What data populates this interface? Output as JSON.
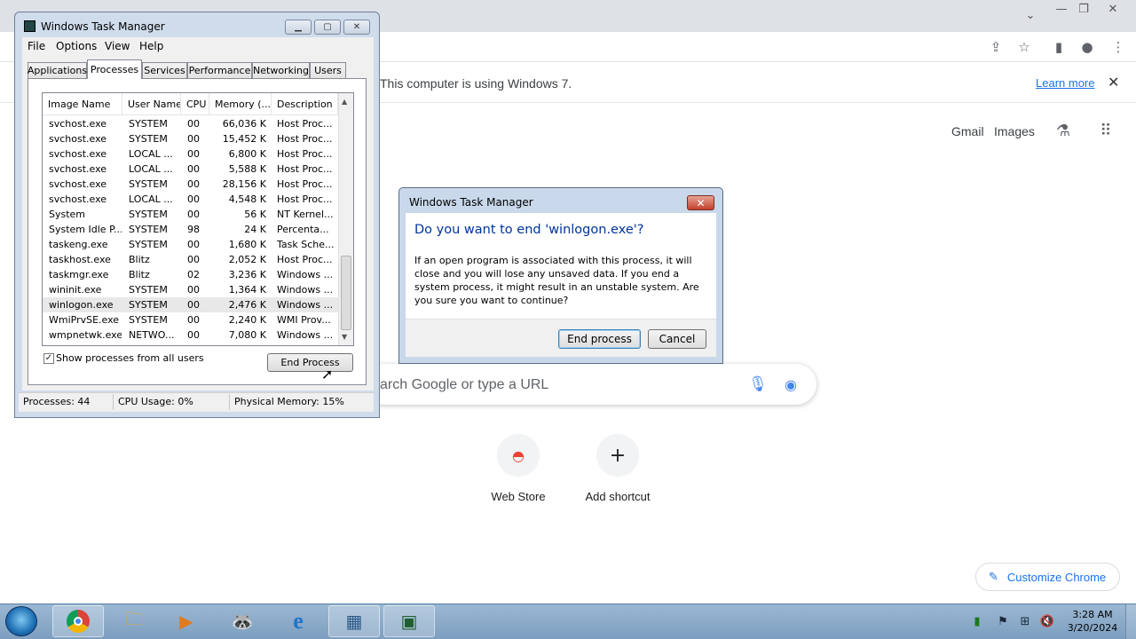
{
  "browser": {
    "infobar": {
      "message": "This computer is using Windows 7.",
      "link": "Learn more"
    },
    "top_links": [
      "Gmail",
      "Images"
    ],
    "search_placeholder": "arch Google or type a URL",
    "shortcuts": [
      {
        "label": "Web Store"
      },
      {
        "label": "Add shortcut"
      }
    ],
    "customize_label": "Customize Chrome",
    "colors": {
      "link": "#1a73e8",
      "tabbar": "#dee1e6"
    }
  },
  "task_manager": {
    "title": "Windows Task Manager",
    "menu": [
      "File",
      "Options",
      "View",
      "Help"
    ],
    "tabs": [
      "Applications",
      "Processes",
      "Services",
      "Performance",
      "Networking",
      "Users"
    ],
    "active_tab": "Processes",
    "columns": [
      "Image Name",
      "User Name",
      "CPU",
      "Memory (...",
      "Description"
    ],
    "rows": [
      [
        "svchost.exe",
        "SYSTEM",
        "00",
        "66,036 K",
        "Host Proc..."
      ],
      [
        "svchost.exe",
        "SYSTEM",
        "00",
        "15,452 K",
        "Host Proc..."
      ],
      [
        "svchost.exe",
        "LOCAL ...",
        "00",
        "6,800 K",
        "Host Proc..."
      ],
      [
        "svchost.exe",
        "LOCAL ...",
        "00",
        "5,588 K",
        "Host Proc..."
      ],
      [
        "svchost.exe",
        "SYSTEM",
        "00",
        "28,156 K",
        "Host Proc..."
      ],
      [
        "svchost.exe",
        "LOCAL ...",
        "00",
        "4,548 K",
        "Host Proc..."
      ],
      [
        "System",
        "SYSTEM",
        "00",
        "56 K",
        "NT Kernel..."
      ],
      [
        "System Idle P...",
        "SYSTEM",
        "98",
        "24 K",
        "Percenta..."
      ],
      [
        "taskeng.exe",
        "SYSTEM",
        "00",
        "1,680 K",
        "Task Sche..."
      ],
      [
        "taskhost.exe",
        "Blitz",
        "00",
        "2,052 K",
        "Host Proc..."
      ],
      [
        "taskmgr.exe",
        "Blitz",
        "02",
        "3,236 K",
        "Windows ..."
      ],
      [
        "wininit.exe",
        "SYSTEM",
        "00",
        "1,364 K",
        "Windows ..."
      ],
      [
        "winlogon.exe",
        "SYSTEM",
        "00",
        "2,476 K",
        "Windows ..."
      ],
      [
        "WmiPrvSE.exe",
        "SYSTEM",
        "00",
        "2,240 K",
        "WMI Prov..."
      ],
      [
        "wmpnetwk.exe",
        "NETWO...",
        "00",
        "7,080 K",
        "Windows ..."
      ]
    ],
    "selected_row": 12,
    "show_all_label": "Show processes from all users",
    "show_all_checked": true,
    "end_process_label": "End Process",
    "status": {
      "processes": "Processes: 44",
      "cpu": "CPU Usage: 0%",
      "memory": "Physical Memory: 15%"
    }
  },
  "dialog": {
    "title": "Windows Task Manager",
    "heading": "Do you want to end 'winlogon.exe'?",
    "body": "If an open program is associated with this process, it will close and you will lose any unsaved data. If you end a system process, it might result in an unstable system. Are you sure you want to continue?",
    "confirm_label": "End process",
    "cancel_label": "Cancel",
    "colors": {
      "heading": "#003399"
    }
  },
  "taskbar": {
    "apps": [
      {
        "icon": "chrome-icon",
        "open": true
      },
      {
        "icon": "file-explorer-icon",
        "open": false
      },
      {
        "icon": "media-player-icon",
        "open": false
      },
      {
        "icon": "raccoon-app-icon",
        "open": false
      },
      {
        "icon": "internet-explorer-icon",
        "open": false
      },
      {
        "icon": "control-panel-icon",
        "open": true
      },
      {
        "icon": "task-manager-icon",
        "open": true
      }
    ],
    "clock_time": "3:28 AM",
    "clock_date": "3/20/2024"
  }
}
